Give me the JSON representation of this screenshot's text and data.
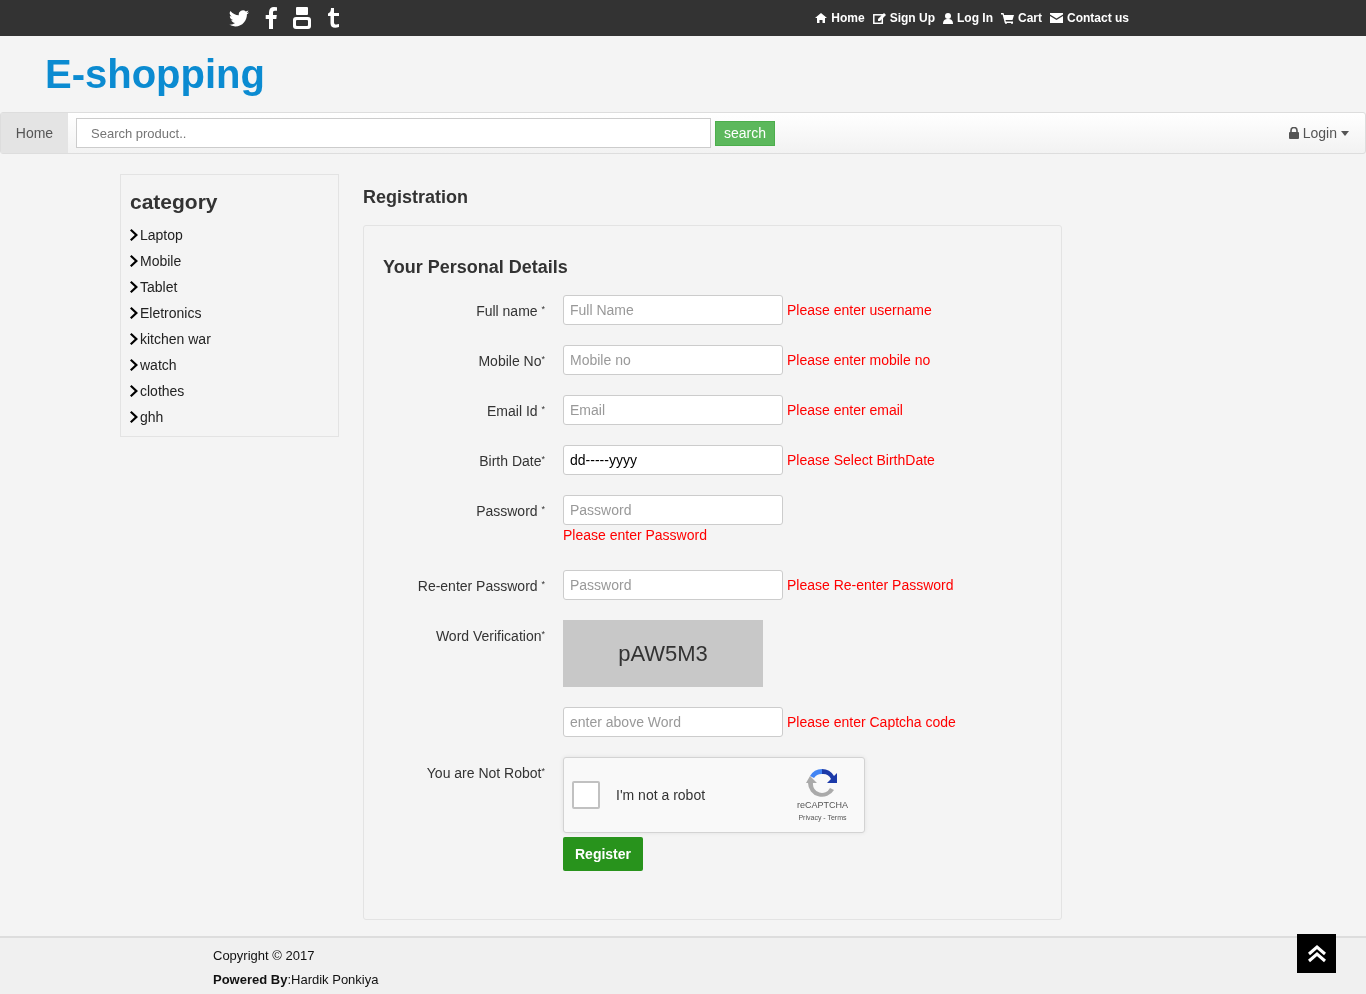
{
  "topbar": {
    "links": [
      {
        "label": "Home"
      },
      {
        "label": "Sign Up"
      },
      {
        "label": "Log In"
      },
      {
        "label": "Cart"
      },
      {
        "label": "Contact us"
      }
    ]
  },
  "logo": "E-shopping",
  "navbar": {
    "home": "Home",
    "search": {
      "placeholder": "Search product.."
    },
    "search_button": "search",
    "login": "Login"
  },
  "sidebar": {
    "title": "category",
    "items": [
      "Laptop",
      "Mobile",
      "Tablet",
      "Eletronics",
      "kitchen war",
      "watch",
      "clothes",
      "ghh"
    ]
  },
  "page_title": "Registration",
  "form": {
    "title": "Your Personal Details",
    "fields": [
      {
        "kind": "input",
        "label": "Full name $^{*}$",
        "placeholder": "Full Name",
        "error": "Please enter username",
        "error_below": false
      },
      {
        "kind": "input",
        "label": "Mobile No$^{*}$",
        "placeholder": "Mobile no",
        "error": "Please enter mobile no",
        "error_below": false
      },
      {
        "kind": "input",
        "label": "Email Id $^{*}$",
        "placeholder": "Email",
        "error": "Please enter email",
        "error_below": false
      },
      {
        "kind": "input",
        "label": "Birth Date$^{*}$",
        "value": "dd-----yyyy",
        "error": "Please Select BirthDate",
        "error_below": false
      },
      {
        "kind": "input",
        "label": "Password $^{*}$",
        "placeholder": "Password",
        "error": "Please enter Password",
        "error_below": true
      },
      {
        "kind": "input",
        "label": "Re-enter Password $^{*}$",
        "placeholder": "Password",
        "error": "Please Re-enter Password",
        "error_below": false
      },
      {
        "kind": "captcha",
        "label": "Word Verification$^{*}$",
        "code": "pAW5M3",
        "placeholder": "enter above Word",
        "error": "Please enter Captcha code"
      },
      {
        "kind": "recaptcha",
        "label": "You are Not Robot$^{*}$",
        "checked": false,
        "text": "I'm not a robot",
        "brand": "reCAPTCHA",
        "links": "Privacy - Terms"
      }
    ],
    "submit": "Register"
  },
  "footer": {
    "copyright": "Copyright © 2017",
    "powered": "**Powered By**:Hardik Ponkiya"
  }
}
